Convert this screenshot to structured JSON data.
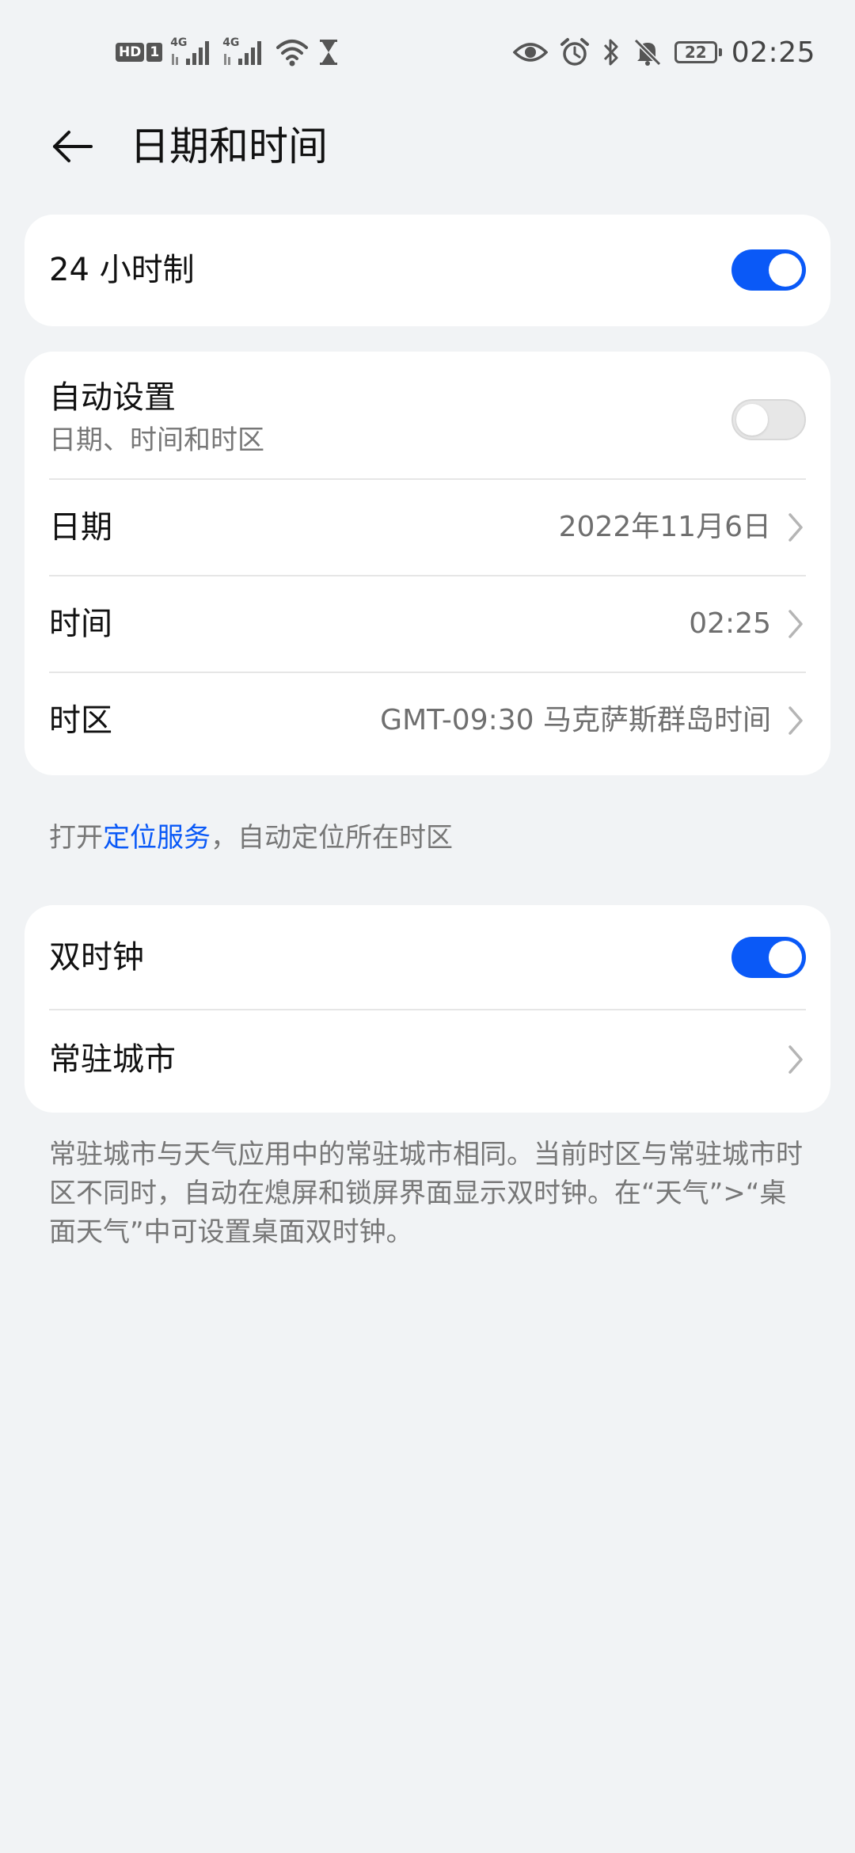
{
  "status_bar": {
    "hd": "HD",
    "sim": "1",
    "signal1_label": "4G",
    "signal2_label": "4G",
    "battery": "22",
    "time": "02:25"
  },
  "header": {
    "title": "日期和时间"
  },
  "card_24h": {
    "label": "24 小时制",
    "enabled": true
  },
  "card_datetime": {
    "auto": {
      "label": "自动设置",
      "subtitle": "日期、时间和时区",
      "enabled": false
    },
    "date": {
      "label": "日期",
      "value": "2022年11月6日"
    },
    "time": {
      "label": "时间",
      "value": "02:25"
    },
    "timezone": {
      "label": "时区",
      "value": "GMT-09:30 马克萨斯群岛时间"
    }
  },
  "location_note": {
    "prefix": "打开",
    "link": "定位服务",
    "suffix": "，自动定位所在时区"
  },
  "card_dual": {
    "dual_clock": {
      "label": "双时钟",
      "enabled": true
    },
    "home_city": {
      "label": "常驻城市"
    }
  },
  "dual_note": "常驻城市与天气应用中的常驻城市相同。当前时区与常驻城市时区不同时，自动在熄屏和锁屏界面显示双时钟。在“天气”>“桌面天气”中可设置桌面双时钟。",
  "colors": {
    "accent": "#0a59f7",
    "background": "#f1f3f5",
    "card": "#ffffff"
  }
}
